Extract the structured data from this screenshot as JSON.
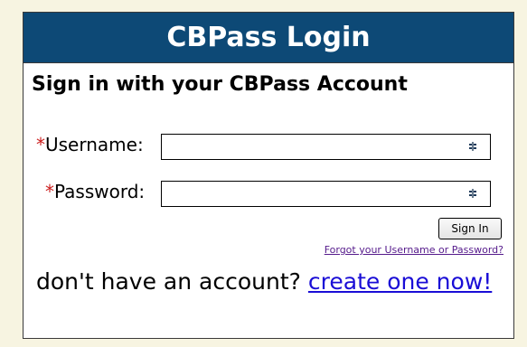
{
  "header": {
    "title": "CBPass Login"
  },
  "subtitle": "Sign in with your CBPass Account",
  "form": {
    "required_marker": "*",
    "username_label": "Username:",
    "username_value": "",
    "password_label": "Password:",
    "password_value": "",
    "field_icon": "password-manager-key-icon",
    "signin_label": "Sign In",
    "forgot_link": "Forgot your Username or Password?"
  },
  "signup": {
    "prompt": "don't have an account?",
    "link": "create one now!"
  },
  "colors": {
    "background": "#f7f4e1",
    "header_bg": "#0d4976",
    "required": "#cc1f1f",
    "link": "#1a0dd6",
    "visited_link": "#551a8b"
  }
}
